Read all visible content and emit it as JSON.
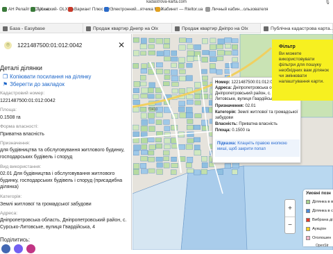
{
  "browser": {
    "url": "kadastrova-karta.com",
    "bookmarks": [
      {
        "label": "АН Релайт – OLX.ua",
        "color": "#3a7a3a"
      },
      {
        "label": "Гусинский- OLX.ua",
        "color": "#3a7a3a"
      },
      {
        "label": "Вариант Плюс АН",
        "color": "#c83a2a"
      },
      {
        "label": "Электронний...ятчика Мой",
        "color": "#2a6ac8"
      },
      {
        "label": "Кабинет — Rieltor.ua",
        "color": "#e0a020"
      },
      {
        "label": "Личный кабин...ользователя",
        "color": "#999"
      }
    ],
    "tabs": [
      {
        "label": "База - Easybase",
        "active": false
      },
      {
        "label": "Продаж квартир Днепр на Olx",
        "active": false
      },
      {
        "label": "Продаж квартир Дніпро на Olx",
        "active": false
      },
      {
        "label": "Публічна кадастрова карта...",
        "active": true
      }
    ]
  },
  "panel": {
    "cadastral_number": "1221487500:01:012:0042",
    "title": "Деталі ділянки",
    "actions": {
      "copy_link": "Копіювати посилання на ділянку",
      "bookmark": "Зберегти до закладок"
    },
    "fields": {
      "cadnum_label": "Кадастровий номер:",
      "cadnum_value": "1221487500:01:012:0042",
      "area_label": "Площа:",
      "area_value": "0.1508 га",
      "ownership_label": "Форма власності:",
      "ownership_value": "Приватна власність",
      "purpose_label": "Призначення:",
      "purpose_value": "для будівництва та обслуговування житлового будинку, господарських будівель і споруд",
      "use_label": "Вид використання:",
      "use_value": "02.01 Для будівництва і обслуговування житлового будинку, господарських будівель і споруд (присадибна ділянка)",
      "category_label": "Категорія:",
      "category_value": "Землі житлової та громадської забудови",
      "address_label": "Адреса:",
      "address_value": "Дніпропетровська область, Дніпропетровський район, с. Сурсько-Литовське, вулиця Гвардійська, 4"
    },
    "share_label": "Поділитись:"
  },
  "popup": {
    "number_label": "Номер:",
    "number_value": "1221487500:01:012:0042",
    "address_label": "Адреса:",
    "address_value": "Дніпропетровська область, Дніпропетровський район, с. Сурсько-Литовське, вулиця Гвардійська, 4",
    "purpose_label": "Призначення:",
    "purpose_value": "02.01",
    "category_label": "Категорія:",
    "category_value": "Землі житлової та громадської забудови",
    "ownership_label": "Власність:",
    "ownership_value": "Приватна власність",
    "area_label": "Площа:",
    "area_value": "0.1500 га",
    "hint_label": "Підказка:",
    "hint_text": "Клацніть правою кнопкою миші, щоб закрити попап"
  },
  "filter": {
    "title": "Фільтр",
    "text": "Ви можете використовувати фільтри для пошуку необхідних вам ділянок чи змінювати налаштування карти."
  },
  "legend": {
    "title": "Умовні позн",
    "items": [
      {
        "label": "Ділянка в в",
        "color": "#a6d18c"
      },
      {
        "label": "Ділянка в с",
        "color": "#4a8ad8"
      },
      {
        "label": "Вибрана ді",
        "color": "#e53a2a"
      },
      {
        "label": "Аукціон",
        "color": "#f7d020"
      },
      {
        "label": "Оголошен",
        "color": "#f2b6c8"
      }
    ]
  },
  "map": {
    "attribution": "OpenStr",
    "zoom_in": "+",
    "zoom_out": "−"
  }
}
